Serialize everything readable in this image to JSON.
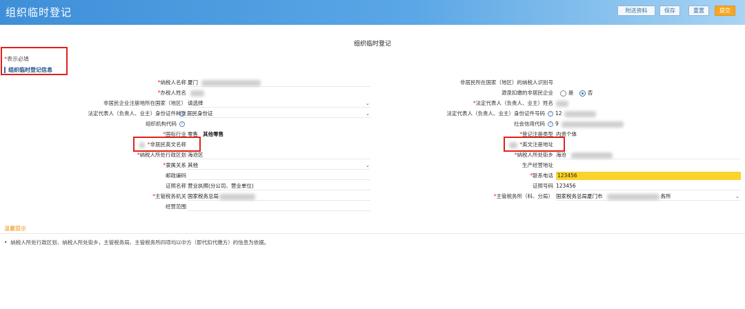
{
  "app": {
    "title": "组织临时登记"
  },
  "toolbar": {
    "attachments": "附送资料",
    "save": "保存",
    "reset": "重置",
    "submit": "提交"
  },
  "form": {
    "title": "组织临时登记",
    "required_note_star": "*",
    "required_note": "表示必填",
    "section_title": "组织临时登记信息",
    "left": {
      "taxpayer_name": {
        "label": "纳税人名称",
        "value": "厦门"
      },
      "agent_name": {
        "label": "办税人姓名",
        "value": ""
      },
      "reg_country": {
        "label": "非居民企业注册地所在国家（地区）",
        "value": "请选择"
      },
      "legal_id_type": {
        "label": "法定代表人（负责人、业主）身份证件种类",
        "value": "居民身份证"
      },
      "org_code": {
        "label": "组织机构代码",
        "value": ""
      },
      "industry": {
        "label": "国标行业",
        "value": "零售",
        "value2": "其他零售"
      },
      "nonres_en_name": {
        "label": "非居民英文名称",
        "value": ""
      },
      "region": {
        "label": "纳税人所处行政区划",
        "value": "海沧区"
      },
      "affiliation": {
        "label": "隶属关系",
        "value": "其他"
      },
      "postcode": {
        "label": "邮政编码",
        "value": ""
      },
      "cert_name": {
        "label": "证照名称",
        "value": "营业执照(分公司、营业单位)"
      },
      "tax_authority": {
        "label": "主管税务机关",
        "value": "国家税务总局"
      },
      "scope": {
        "label": "经营范围",
        "value": ""
      }
    },
    "right": {
      "nonres_id": {
        "label": "非居民所在国家（地区）的纳税人识别号",
        "value": ""
      },
      "withholding": {
        "label": "源泉扣缴的非居民企业",
        "opt_yes": "是",
        "opt_no": "否",
        "selected": "否"
      },
      "legal_name": {
        "label": "法定代表人（负责人、业主）姓名",
        "value": ""
      },
      "legal_id_no": {
        "label": "法定代表人（负责人、业主）身份证件号码",
        "value": "12"
      },
      "credit_code": {
        "label": "社会信用代码",
        "value": "9"
      },
      "reg_type": {
        "label": "登记注册类型",
        "value": "内资个体"
      },
      "en_address": {
        "label": "英文注册地址",
        "value": ""
      },
      "street": {
        "label": "纳税人所处街乡",
        "value": "海沧"
      },
      "biz_address": {
        "label": "生产经营地址",
        "value": ""
      },
      "phone": {
        "label": "联系电话",
        "value": "123456"
      },
      "cert_no": {
        "label": "证照号码",
        "value": "123456"
      },
      "tax_office": {
        "label": "主管税务所（科、分局）",
        "value": "国家税务总局厦门市",
        "suffix": "务所"
      }
    }
  },
  "hint": {
    "title": "温馨提示",
    "text": "纳税人所处行政区划、纳税人所处街乡，主管税务局、主管税务所四项均以中方（即代扣代缴方）的信息为依据。"
  },
  "colors": {
    "required": "#e0201a",
    "highlight": "#fcd32c",
    "header": "#3f8fd8",
    "accent": "#f5a623"
  },
  "icons": {
    "help": "help-icon",
    "caret": "chevron-down-icon"
  }
}
